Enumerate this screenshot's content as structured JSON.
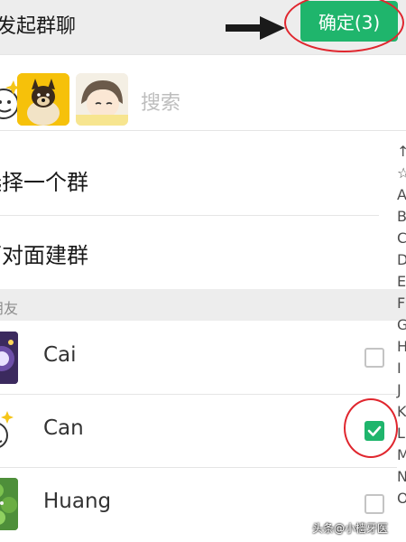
{
  "header": {
    "title": "发起群聊",
    "confirm_label": "确定(3)"
  },
  "search": {
    "placeholder": "搜索"
  },
  "menu": [
    {
      "label": "选择一个群"
    },
    {
      "label": "面对面建群"
    }
  ],
  "section": {
    "label": "朋友"
  },
  "contacts": [
    {
      "name": "Cai",
      "checked": false
    },
    {
      "name": "Can",
      "checked": true
    },
    {
      "name": "Huang",
      "checked": false
    }
  ],
  "index_letters": [
    "↑",
    "☆",
    "A",
    "B",
    "C",
    "D",
    "E",
    "F",
    "G",
    "H",
    "I",
    "J",
    "K",
    "L",
    "M",
    "N",
    "O"
  ],
  "watermark": "头条@小樯牙医",
  "colors": {
    "accent_green": "#1fb56c",
    "annotation_red": "#e0262e",
    "header_bg": "#ededed"
  }
}
